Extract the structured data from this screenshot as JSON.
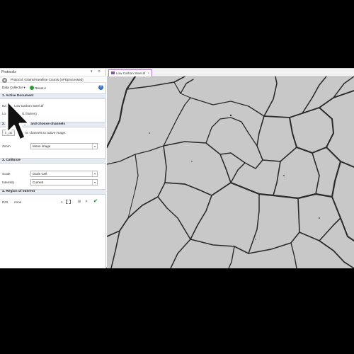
{
  "panel": {
    "title": "Protocols",
    "pin_glyph": "▾",
    "close_glyph": "✕",
    "protocol_name": "Protocol: Grains/Area/line Counts (AFEprocessed)",
    "toolbar": {
      "collector": "Data Collector ▾",
      "reset": "Reset ▾"
    }
  },
  "sections": {
    "s1": "1. Active Document",
    "s2": "2. Enable images and choose channels",
    "s3": "3. Calibrate",
    "s4": "4. Region of Interest"
  },
  "active_document": {
    "name_label": "Name",
    "name_value": "Low Carbon Steel.tif",
    "locations_label": "Locations",
    "locations_value": "1 (1 frames)"
  },
  "channels": {
    "sync_button": "Sync",
    "sync_text": "Sync channels to active image.",
    "zoom_label": "Zoom",
    "zoom_value": "Mono image"
  },
  "calibrate": {
    "scale_label": "Scale",
    "scale_value": "Grain Cell",
    "intensity_label": "Intensity",
    "intensity_value": "Current"
  },
  "roi": {
    "label": "ROI",
    "value": "none",
    "count": "1"
  },
  "tab": {
    "label": "Low Carbon Steel.tif"
  },
  "colors": {
    "section_bg": "#e6ebf2",
    "tab_accent": "#b07ac9",
    "help": "#2f6fd0",
    "reset": "#2e9b3a"
  }
}
